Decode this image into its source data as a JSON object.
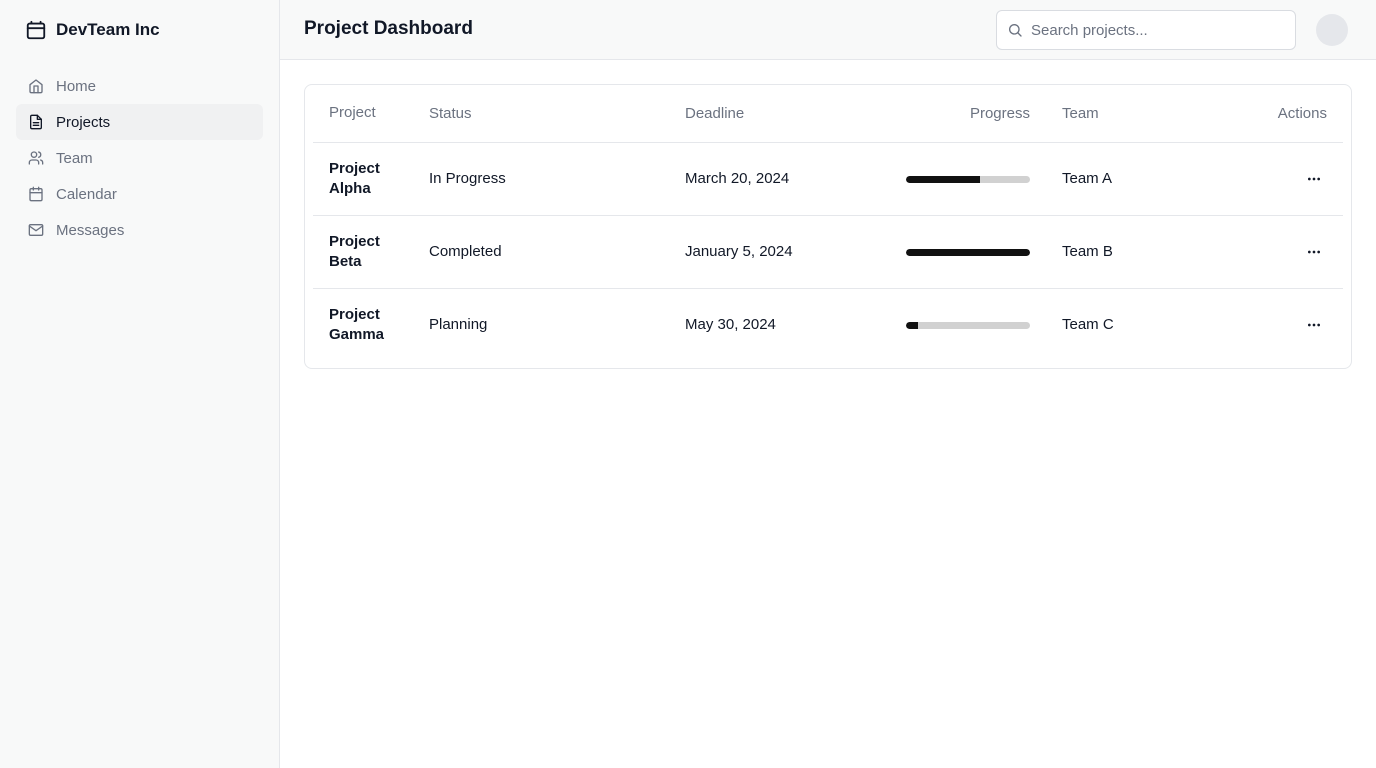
{
  "brand": {
    "name": "DevTeam Inc"
  },
  "sidebar": {
    "items": [
      {
        "label": "Home",
        "icon": "home-icon",
        "active": false
      },
      {
        "label": "Projects",
        "icon": "document-icon",
        "active": true
      },
      {
        "label": "Team",
        "icon": "users-icon",
        "active": false
      },
      {
        "label": "Calendar",
        "icon": "calendar-icon",
        "active": false
      },
      {
        "label": "Messages",
        "icon": "mail-icon",
        "active": false
      }
    ]
  },
  "header": {
    "title": "Project Dashboard",
    "search_placeholder": "Search projects..."
  },
  "table": {
    "columns": [
      "Project",
      "Status",
      "Deadline",
      "Progress",
      "Team",
      "Actions"
    ],
    "rows": [
      {
        "project": "Project Alpha",
        "status": "In Progress",
        "deadline": "March 20, 2024",
        "progress": 0.6,
        "team": "Team A"
      },
      {
        "project": "Project Beta",
        "status": "Completed",
        "deadline": "January 5, 2024",
        "progress": 1.0,
        "team": "Team B"
      },
      {
        "project": "Project Gamma",
        "status": "Planning",
        "deadline": "May 30, 2024",
        "progress": 0.1,
        "team": "Team C"
      }
    ]
  },
  "colors": {
    "progress_fill": "#111111",
    "progress_track": "#d1d1d1",
    "active_nav_bg": "#f0f1f2"
  }
}
